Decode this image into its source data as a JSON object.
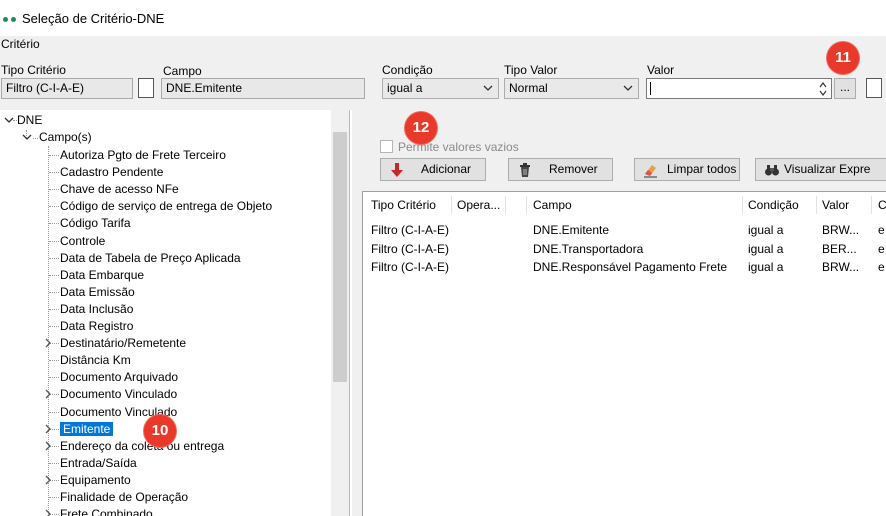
{
  "window": {
    "title": "Seleção de Critério-DNE"
  },
  "criterio": {
    "group_label": "Critério",
    "tipo_criterio": {
      "label": "Tipo Critério",
      "value": "Filtro (C-I-A-E)"
    },
    "campo": {
      "label": "Campo",
      "value": "DNE.Emitente"
    },
    "condicao": {
      "label": "Condição",
      "value": "igual a"
    },
    "tipo_valor": {
      "label": "Tipo Valor",
      "value": "Normal"
    },
    "valor": {
      "label": "Valor",
      "value": "",
      "browse_label": "..."
    }
  },
  "badges": {
    "b10": "10",
    "b11": "11",
    "b12": "12"
  },
  "tree": {
    "root": "DNE",
    "group": "Campo(s)",
    "items": [
      "Autoriza Pgto de Frete Terceiro",
      "Cadastro Pendente",
      "Chave de acesso NFe",
      "Código de serviço de entrega de Objeto",
      "Código Tarifa",
      "Controle",
      "Data de Tabela de Preço Aplicada",
      "Data Embarque",
      "Data Emissão",
      "Data Inclusão",
      "Data Registro",
      "Destinatário/Remetente",
      "Distância Km",
      "Documento Arquivado",
      "Documento Vinculado",
      "Documento Vinculado",
      "Emitente",
      "Endereço da coleta ou entrega",
      "Entrada/Saída",
      "Equipamento",
      "Finalidade de Operação",
      "Frete Combinado"
    ]
  },
  "options": {
    "permite_vazios": "Permite valores vazios"
  },
  "toolbar": {
    "adicionar": "Adicionar",
    "remover": "Remover",
    "limpar": "Limpar todos",
    "visualizar": "Visualizar Expre"
  },
  "grid": {
    "headers": [
      "Tipo Critério",
      "Opera...",
      "Campo",
      "Condição",
      "Valor",
      "C"
    ],
    "rows": [
      [
        "Filtro (C-I-A-E)",
        "",
        "DNE.Emitente",
        "igual a",
        "BRW...",
        "e"
      ],
      [
        "Filtro (C-I-A-E)",
        "",
        "DNE.Transportadora",
        "igual a",
        "BER...",
        "e"
      ],
      [
        "Filtro (C-I-A-E)",
        "",
        "DNE.Responsável Pagamento Frete",
        "igual a",
        "BRW...",
        "e"
      ]
    ]
  },
  "colors": {
    "selection": "#0078d7",
    "badge": "#e8392a",
    "app_icon": "#1f8a55"
  }
}
